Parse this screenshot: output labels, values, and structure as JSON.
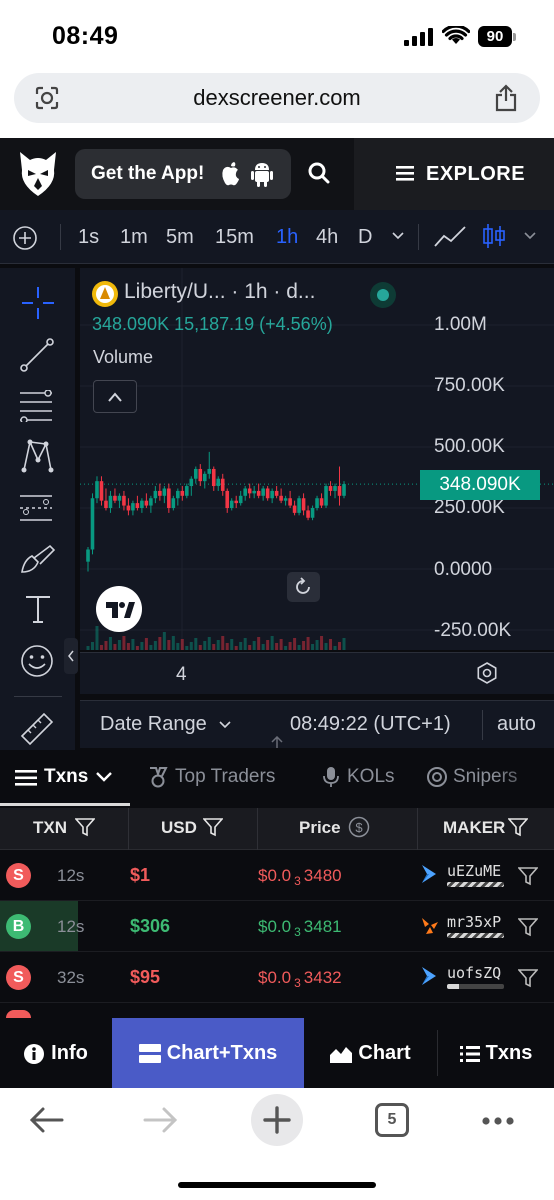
{
  "status_bar": {
    "time": "08:49",
    "battery": "90"
  },
  "browser": {
    "url": "dexscreener.com",
    "tab_count": "5"
  },
  "header": {
    "get_app_label": "Get the App!",
    "explore_label": "EXPLORE"
  },
  "timeframes": {
    "items": [
      "1s",
      "1m",
      "5m",
      "15m",
      "1h",
      "4h",
      "D"
    ],
    "active": "1h"
  },
  "chart": {
    "title": "Liberty/U... · 1h · d...",
    "ohlc": "348.090K  15,187.19 (+4.56%)",
    "volume_label": "Volume",
    "y_ticks": [
      "1.00M",
      "750.00K",
      "500.00K",
      "250.00K",
      "0.0000",
      "-250.00K"
    ],
    "last_price_tag": "348.090K",
    "x_label": "4",
    "up_color": "#089981",
    "down_color": "#f23645"
  },
  "chart_data": {
    "type": "candlestick",
    "title": "Liberty/U... · 1h · d...",
    "ylim": [
      -250000,
      1000000
    ],
    "last_value": 348090,
    "change": "15,187.19 (+4.56%)",
    "x_tick_labels": [
      "4"
    ],
    "candles": [
      {
        "o": 30000,
        "h": 90000,
        "l": -10000,
        "c": 80000
      },
      {
        "o": 80000,
        "h": 310000,
        "l": 60000,
        "c": 290000
      },
      {
        "o": 290000,
        "h": 380000,
        "l": 270000,
        "c": 360000
      },
      {
        "o": 360000,
        "h": 380000,
        "l": 260000,
        "c": 280000
      },
      {
        "o": 280000,
        "h": 330000,
        "l": 240000,
        "c": 250000
      },
      {
        "o": 250000,
        "h": 320000,
        "l": 230000,
        "c": 300000
      },
      {
        "o": 300000,
        "h": 330000,
        "l": 270000,
        "c": 280000
      },
      {
        "o": 280000,
        "h": 310000,
        "l": 250000,
        "c": 300000
      },
      {
        "o": 300000,
        "h": 320000,
        "l": 240000,
        "c": 260000
      },
      {
        "o": 260000,
        "h": 290000,
        "l": 220000,
        "c": 240000
      },
      {
        "o": 240000,
        "h": 280000,
        "l": 220000,
        "c": 270000
      },
      {
        "o": 270000,
        "h": 300000,
        "l": 240000,
        "c": 250000
      },
      {
        "o": 250000,
        "h": 290000,
        "l": 230000,
        "c": 280000
      },
      {
        "o": 280000,
        "h": 310000,
        "l": 250000,
        "c": 260000
      },
      {
        "o": 260000,
        "h": 300000,
        "l": 230000,
        "c": 290000
      },
      {
        "o": 290000,
        "h": 340000,
        "l": 270000,
        "c": 320000
      },
      {
        "o": 320000,
        "h": 350000,
        "l": 280000,
        "c": 300000
      },
      {
        "o": 300000,
        "h": 340000,
        "l": 270000,
        "c": 330000
      },
      {
        "o": 330000,
        "h": 350000,
        "l": 230000,
        "c": 250000
      },
      {
        "o": 250000,
        "h": 300000,
        "l": 240000,
        "c": 290000
      },
      {
        "o": 290000,
        "h": 330000,
        "l": 260000,
        "c": 320000
      },
      {
        "o": 320000,
        "h": 340000,
        "l": 280000,
        "c": 300000
      },
      {
        "o": 300000,
        "h": 350000,
        "l": 290000,
        "c": 340000
      },
      {
        "o": 340000,
        "h": 380000,
        "l": 300000,
        "c": 370000
      },
      {
        "o": 370000,
        "h": 420000,
        "l": 350000,
        "c": 410000
      },
      {
        "o": 410000,
        "h": 430000,
        "l": 340000,
        "c": 360000
      },
      {
        "o": 360000,
        "h": 400000,
        "l": 330000,
        "c": 390000
      },
      {
        "o": 390000,
        "h": 480000,
        "l": 370000,
        "c": 410000
      },
      {
        "o": 410000,
        "h": 420000,
        "l": 320000,
        "c": 340000
      },
      {
        "o": 340000,
        "h": 380000,
        "l": 320000,
        "c": 370000
      },
      {
        "o": 370000,
        "h": 390000,
        "l": 300000,
        "c": 320000
      },
      {
        "o": 320000,
        "h": 330000,
        "l": 230000,
        "c": 250000
      },
      {
        "o": 250000,
        "h": 290000,
        "l": 240000,
        "c": 280000
      },
      {
        "o": 280000,
        "h": 300000,
        "l": 250000,
        "c": 270000
      },
      {
        "o": 270000,
        "h": 320000,
        "l": 260000,
        "c": 300000
      },
      {
        "o": 300000,
        "h": 340000,
        "l": 280000,
        "c": 330000
      },
      {
        "o": 330000,
        "h": 350000,
        "l": 290000,
        "c": 310000
      },
      {
        "o": 310000,
        "h": 340000,
        "l": 290000,
        "c": 320000
      },
      {
        "o": 320000,
        "h": 350000,
        "l": 290000,
        "c": 300000
      },
      {
        "o": 300000,
        "h": 340000,
        "l": 280000,
        "c": 330000
      },
      {
        "o": 330000,
        "h": 340000,
        "l": 280000,
        "c": 290000
      },
      {
        "o": 290000,
        "h": 330000,
        "l": 270000,
        "c": 320000
      },
      {
        "o": 320000,
        "h": 340000,
        "l": 290000,
        "c": 300000
      },
      {
        "o": 300000,
        "h": 330000,
        "l": 270000,
        "c": 280000
      },
      {
        "o": 280000,
        "h": 300000,
        "l": 260000,
        "c": 290000
      },
      {
        "o": 290000,
        "h": 320000,
        "l": 250000,
        "c": 260000
      },
      {
        "o": 260000,
        "h": 280000,
        "l": 220000,
        "c": 230000
      },
      {
        "o": 230000,
        "h": 300000,
        "l": 220000,
        "c": 290000
      },
      {
        "o": 290000,
        "h": 310000,
        "l": 220000,
        "c": 240000
      },
      {
        "o": 240000,
        "h": 260000,
        "l": 200000,
        "c": 210000
      },
      {
        "o": 210000,
        "h": 260000,
        "l": 200000,
        "c": 250000
      },
      {
        "o": 250000,
        "h": 300000,
        "l": 240000,
        "c": 290000
      },
      {
        "o": 290000,
        "h": 310000,
        "l": 250000,
        "c": 260000
      },
      {
        "o": 260000,
        "h": 350000,
        "l": 250000,
        "c": 340000
      },
      {
        "o": 340000,
        "h": 360000,
        "l": 300000,
        "c": 320000
      },
      {
        "o": 320000,
        "h": 350000,
        "l": 290000,
        "c": 340000
      },
      {
        "o": 340000,
        "h": 420000,
        "l": 260000,
        "c": 300000
      },
      {
        "o": 300000,
        "h": 360000,
        "l": 290000,
        "c": 348090
      }
    ]
  },
  "date_bar": {
    "date_range": "Date Range",
    "clock": "08:49:22 (UTC+1)",
    "auto": "auto"
  },
  "tabs": {
    "items": [
      "Txns",
      "Top Traders",
      "KOLs",
      "Snipers"
    ]
  },
  "table": {
    "headers": [
      "TXN",
      "USD",
      "Price",
      "MAKER"
    ],
    "rows": [
      {
        "type": "S",
        "age": "12s",
        "usd": "$1",
        "price_prefix": "$0.0",
        "price_zeros": "3",
        "price_digits": "3480",
        "maker": "uEZuME"
      },
      {
        "type": "B",
        "age": "12s",
        "usd": "$306",
        "price_prefix": "$0.0",
        "price_zeros": "3",
        "price_digits": "3481",
        "maker": "mr35xP"
      },
      {
        "type": "S",
        "age": "32s",
        "usd": "$95",
        "price_prefix": "$0.0",
        "price_zeros": "3",
        "price_digits": "3432",
        "maker": "uofsZQ"
      }
    ]
  },
  "bottom_nav": {
    "info": "Info",
    "chart_txns": "Chart+Txns",
    "chart": "Chart",
    "txns": "Txns"
  },
  "colors": {
    "sell": "#f15b5b",
    "buy": "#3dba73",
    "active_nav": "#4a5bc7",
    "accent_blue": "#2962ff"
  }
}
